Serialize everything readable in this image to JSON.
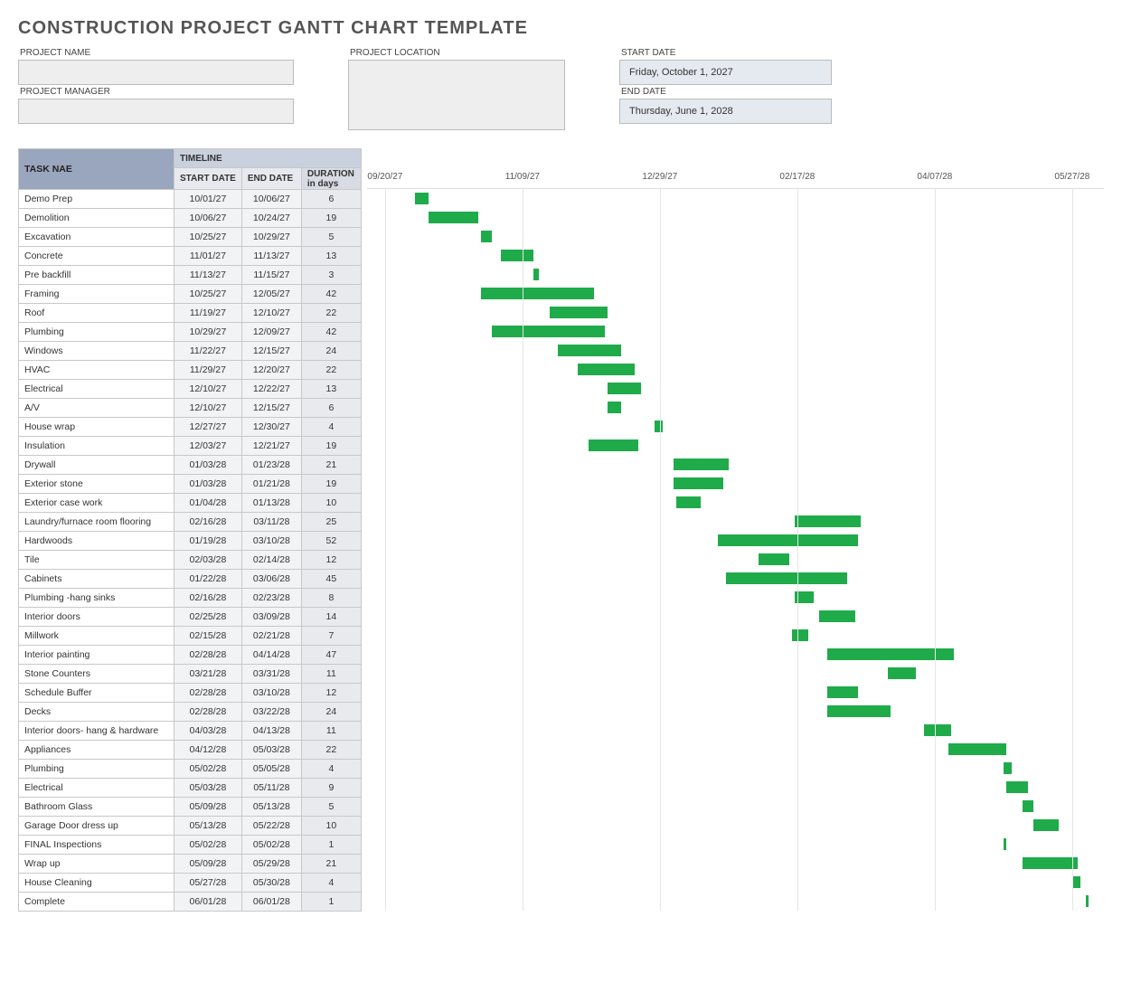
{
  "title": "CONSTRUCTION PROJECT GANTT CHART TEMPLATE",
  "labels": {
    "project_name": "PROJECT NAME",
    "project_manager": "PROJECT MANAGER",
    "project_location": "PROJECT LOCATION",
    "start_date": "START DATE",
    "end_date": "END DATE"
  },
  "fields": {
    "project_name": "",
    "project_manager": "",
    "project_location": "",
    "start_date": "Friday, October 1, 2027",
    "end_date": "Thursday, June 1, 2028"
  },
  "headers": {
    "timeline": "TIMELINE",
    "task": "TASK NAE",
    "start": "START DATE",
    "end": "END DATE",
    "dur": "DURATION",
    "dur2": "in days"
  },
  "axis_ticks": [
    "09/20/27",
    "11/09/27",
    "12/29/27",
    "02/17/28",
    "04/07/28",
    "05/27/28"
  ],
  "tasks": [
    {
      "name": "Demo Prep",
      "start": "10/01/27",
      "end": "10/06/27",
      "dur": 6
    },
    {
      "name": "Demolition",
      "start": "10/06/27",
      "end": "10/24/27",
      "dur": 19
    },
    {
      "name": "Excavation",
      "start": "10/25/27",
      "end": "10/29/27",
      "dur": 5
    },
    {
      "name": "Concrete",
      "start": "11/01/27",
      "end": "11/13/27",
      "dur": 13
    },
    {
      "name": "Pre backfill",
      "start": "11/13/27",
      "end": "11/15/27",
      "dur": 3
    },
    {
      "name": "Framing",
      "start": "10/25/27",
      "end": "12/05/27",
      "dur": 42
    },
    {
      "name": "Roof",
      "start": "11/19/27",
      "end": "12/10/27",
      "dur": 22
    },
    {
      "name": "Plumbing",
      "start": "10/29/27",
      "end": "12/09/27",
      "dur": 42
    },
    {
      "name": "Windows",
      "start": "11/22/27",
      "end": "12/15/27",
      "dur": 24
    },
    {
      "name": "HVAC",
      "start": "11/29/27",
      "end": "12/20/27",
      "dur": 22
    },
    {
      "name": "Electrical",
      "start": "12/10/27",
      "end": "12/22/27",
      "dur": 13
    },
    {
      "name": "A/V",
      "start": "12/10/27",
      "end": "12/15/27",
      "dur": 6
    },
    {
      "name": "House wrap",
      "start": "12/27/27",
      "end": "12/30/27",
      "dur": 4
    },
    {
      "name": "Insulation",
      "start": "12/03/27",
      "end": "12/21/27",
      "dur": 19
    },
    {
      "name": "Drywall",
      "start": "01/03/28",
      "end": "01/23/28",
      "dur": 21
    },
    {
      "name": "Exterior stone",
      "start": "01/03/28",
      "end": "01/21/28",
      "dur": 19
    },
    {
      "name": "Exterior case work",
      "start": "01/04/28",
      "end": "01/13/28",
      "dur": 10
    },
    {
      "name": "Laundry/furnace room flooring",
      "start": "02/16/28",
      "end": "03/11/28",
      "dur": 25
    },
    {
      "name": "Hardwoods",
      "start": "01/19/28",
      "end": "03/10/28",
      "dur": 52
    },
    {
      "name": "Tile",
      "start": "02/03/28",
      "end": "02/14/28",
      "dur": 12
    },
    {
      "name": "Cabinets",
      "start": "01/22/28",
      "end": "03/06/28",
      "dur": 45
    },
    {
      "name": "Plumbing -hang sinks",
      "start": "02/16/28",
      "end": "02/23/28",
      "dur": 8
    },
    {
      "name": "Interior doors",
      "start": "02/25/28",
      "end": "03/09/28",
      "dur": 14
    },
    {
      "name": "Millwork",
      "start": "02/15/28",
      "end": "02/21/28",
      "dur": 7
    },
    {
      "name": "Interior painting",
      "start": "02/28/28",
      "end": "04/14/28",
      "dur": 47
    },
    {
      "name": "Stone Counters",
      "start": "03/21/28",
      "end": "03/31/28",
      "dur": 11
    },
    {
      "name": "Schedule Buffer",
      "start": "02/28/28",
      "end": "03/10/28",
      "dur": 12
    },
    {
      "name": "Decks",
      "start": "02/28/28",
      "end": "03/22/28",
      "dur": 24
    },
    {
      "name": "Interior doors- hang & hardware",
      "start": "04/03/28",
      "end": "04/13/28",
      "dur": 11
    },
    {
      "name": "Appliances",
      "start": "04/12/28",
      "end": "05/03/28",
      "dur": 22
    },
    {
      "name": "Plumbing",
      "start": "05/02/28",
      "end": "05/05/28",
      "dur": 4
    },
    {
      "name": "Electrical",
      "start": "05/03/28",
      "end": "05/11/28",
      "dur": 9
    },
    {
      "name": "Bathroom Glass",
      "start": "05/09/28",
      "end": "05/13/28",
      "dur": 5
    },
    {
      "name": "Garage Door dress up",
      "start": "05/13/28",
      "end": "05/22/28",
      "dur": 10
    },
    {
      "name": "FINAL Inspections",
      "start": "05/02/28",
      "end": "05/02/28",
      "dur": 1
    },
    {
      "name": "Wrap up",
      "start": "05/09/28",
      "end": "05/29/28",
      "dur": 21
    },
    {
      "name": "House Cleaning",
      "start": "05/27/28",
      "end": "05/30/28",
      "dur": 4
    },
    {
      "name": "Complete",
      "start": "06/01/28",
      "end": "06/01/28",
      "dur": 1
    }
  ],
  "chart_data": {
    "type": "bar",
    "title": "CONSTRUCTION PROJECT GANTT CHART TEMPLATE",
    "xlabel": "",
    "ylabel": "",
    "x_range": [
      "09/20/27",
      "05/27/28"
    ],
    "x_ticks": [
      "09/20/27",
      "11/09/27",
      "12/29/27",
      "02/17/28",
      "04/07/28",
      "05/27/28"
    ],
    "series": [
      {
        "name": "Demo Prep",
        "start": "10/01/27",
        "end": "10/06/27",
        "duration_days": 6
      },
      {
        "name": "Demolition",
        "start": "10/06/27",
        "end": "10/24/27",
        "duration_days": 19
      },
      {
        "name": "Excavation",
        "start": "10/25/27",
        "end": "10/29/27",
        "duration_days": 5
      },
      {
        "name": "Concrete",
        "start": "11/01/27",
        "end": "11/13/27",
        "duration_days": 13
      },
      {
        "name": "Pre backfill",
        "start": "11/13/27",
        "end": "11/15/27",
        "duration_days": 3
      },
      {
        "name": "Framing",
        "start": "10/25/27",
        "end": "12/05/27",
        "duration_days": 42
      },
      {
        "name": "Roof",
        "start": "11/19/27",
        "end": "12/10/27",
        "duration_days": 22
      },
      {
        "name": "Plumbing",
        "start": "10/29/27",
        "end": "12/09/27",
        "duration_days": 42
      },
      {
        "name": "Windows",
        "start": "11/22/27",
        "end": "12/15/27",
        "duration_days": 24
      },
      {
        "name": "HVAC",
        "start": "11/29/27",
        "end": "12/20/27",
        "duration_days": 22
      },
      {
        "name": "Electrical",
        "start": "12/10/27",
        "end": "12/22/27",
        "duration_days": 13
      },
      {
        "name": "A/V",
        "start": "12/10/27",
        "end": "12/15/27",
        "duration_days": 6
      },
      {
        "name": "House wrap",
        "start": "12/27/27",
        "end": "12/30/27",
        "duration_days": 4
      },
      {
        "name": "Insulation",
        "start": "12/03/27",
        "end": "12/21/27",
        "duration_days": 19
      },
      {
        "name": "Drywall",
        "start": "01/03/28",
        "end": "01/23/28",
        "duration_days": 21
      },
      {
        "name": "Exterior stone",
        "start": "01/03/28",
        "end": "01/21/28",
        "duration_days": 19
      },
      {
        "name": "Exterior case work",
        "start": "01/04/28",
        "end": "01/13/28",
        "duration_days": 10
      },
      {
        "name": "Laundry/furnace room flooring",
        "start": "02/16/28",
        "end": "03/11/28",
        "duration_days": 25
      },
      {
        "name": "Hardwoods",
        "start": "01/19/28",
        "end": "03/10/28",
        "duration_days": 52
      },
      {
        "name": "Tile",
        "start": "02/03/28",
        "end": "02/14/28",
        "duration_days": 12
      },
      {
        "name": "Cabinets",
        "start": "01/22/28",
        "end": "03/06/28",
        "duration_days": 45
      },
      {
        "name": "Plumbing -hang sinks",
        "start": "02/16/28",
        "end": "02/23/28",
        "duration_days": 8
      },
      {
        "name": "Interior doors",
        "start": "02/25/28",
        "end": "03/09/28",
        "duration_days": 14
      },
      {
        "name": "Millwork",
        "start": "02/15/28",
        "end": "02/21/28",
        "duration_days": 7
      },
      {
        "name": "Interior painting",
        "start": "02/28/28",
        "end": "04/14/28",
        "duration_days": 47
      },
      {
        "name": "Stone Counters",
        "start": "03/21/28",
        "end": "03/31/28",
        "duration_days": 11
      },
      {
        "name": "Schedule Buffer",
        "start": "02/28/28",
        "end": "03/10/28",
        "duration_days": 12
      },
      {
        "name": "Decks",
        "start": "02/28/28",
        "end": "03/22/28",
        "duration_days": 24
      },
      {
        "name": "Interior doors- hang & hardware",
        "start": "04/03/28",
        "end": "04/13/28",
        "duration_days": 11
      },
      {
        "name": "Appliances",
        "start": "04/12/28",
        "end": "05/03/28",
        "duration_days": 22
      },
      {
        "name": "Plumbing",
        "start": "05/02/28",
        "end": "05/05/28",
        "duration_days": 4
      },
      {
        "name": "Electrical",
        "start": "05/03/28",
        "end": "05/11/28",
        "duration_days": 9
      },
      {
        "name": "Bathroom Glass",
        "start": "05/09/28",
        "end": "05/13/28",
        "duration_days": 5
      },
      {
        "name": "Garage Door dress up",
        "start": "05/13/28",
        "end": "05/22/28",
        "duration_days": 10
      },
      {
        "name": "FINAL Inspections",
        "start": "05/02/28",
        "end": "05/02/28",
        "duration_days": 1
      },
      {
        "name": "Wrap up",
        "start": "05/09/28",
        "end": "05/29/28",
        "duration_days": 21
      },
      {
        "name": "House Cleaning",
        "start": "05/27/28",
        "end": "05/30/28",
        "duration_days": 4
      },
      {
        "name": "Complete",
        "start": "06/01/28",
        "end": "06/01/28",
        "duration_days": 1
      }
    ]
  }
}
